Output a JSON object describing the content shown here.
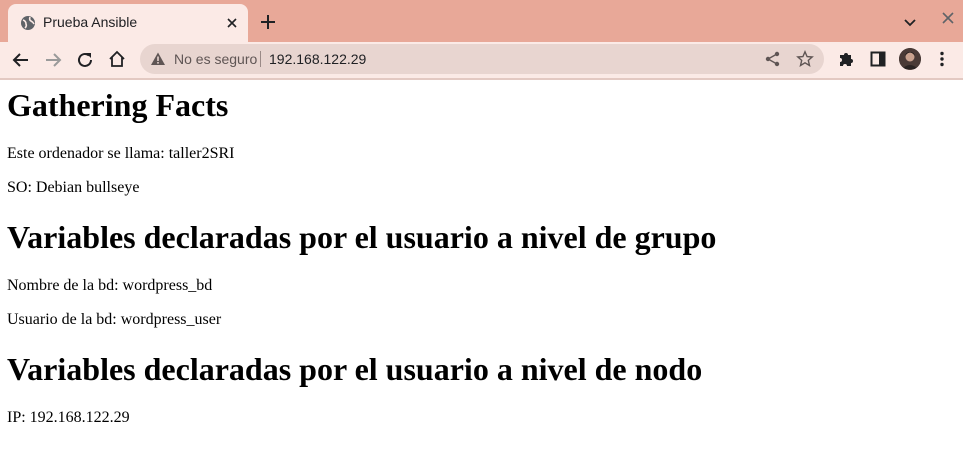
{
  "browser": {
    "tab": {
      "title": "Prueba Ansible",
      "favicon": "globe-icon"
    },
    "omnibox": {
      "security_label": "No es seguro",
      "url": "192.168.122.29"
    }
  },
  "page": {
    "sections": [
      {
        "heading": "Gathering Facts",
        "lines": [
          "Este ordenador se llama: taller2SRI",
          "SO: Debian bullseye"
        ]
      },
      {
        "heading": "Variables declaradas por el usuario a nivel de grupo",
        "lines": [
          "Nombre de la bd: wordpress_bd",
          "Usuario de la bd: wordpress_user"
        ]
      },
      {
        "heading": "Variables declaradas por el usuario a nivel de nodo",
        "lines": [
          "IP: 192.168.122.29"
        ]
      }
    ]
  },
  "colors": {
    "tabstrip": "#e8a898",
    "toolbar": "#fbeae6",
    "omnibox": "#e8d5d0"
  }
}
